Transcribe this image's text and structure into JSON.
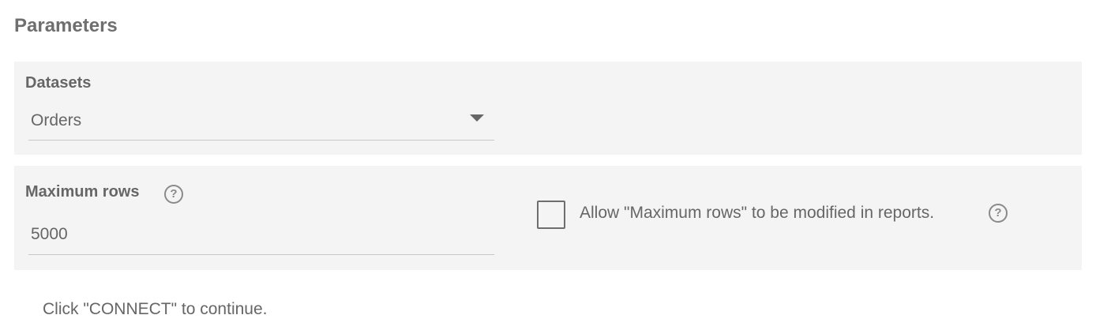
{
  "section_title": "Parameters",
  "datasets": {
    "label": "Datasets",
    "selected_value": "Orders",
    "dropdown_icon": "caret-down-icon"
  },
  "maximum_rows": {
    "label": "Maximum rows",
    "help_icon": "help-circle-icon",
    "value": "5000",
    "allow_modify_checkbox": {
      "checked": false,
      "label": "Allow \"Maximum rows\" to be modified in reports.",
      "help_icon": "help-circle-icon"
    }
  },
  "hint": "Click \"CONNECT\" to continue.",
  "colors": {
    "panel_background": "#f4f4f4",
    "text": "#666666",
    "underline": "#c8c8c8"
  }
}
